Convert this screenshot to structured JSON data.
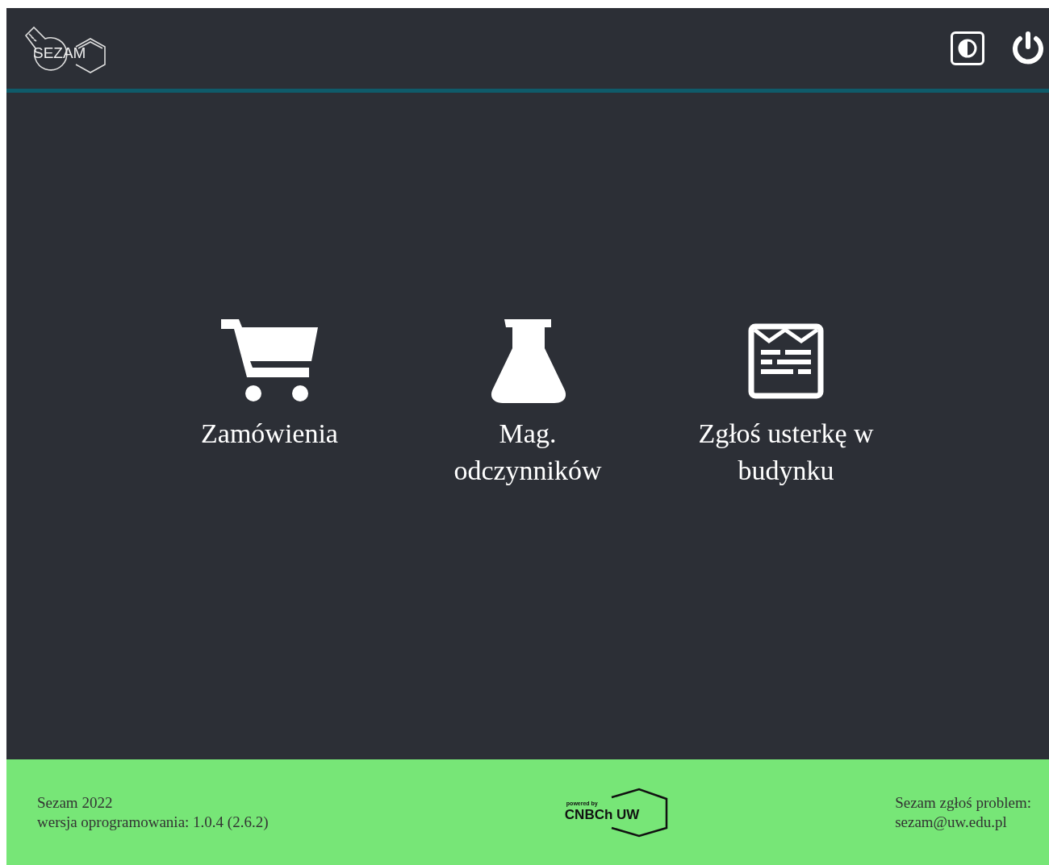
{
  "header": {
    "logo_text": "SEZAM"
  },
  "tiles": [
    {
      "kind": "cart",
      "label": "Zamówienia"
    },
    {
      "kind": "flask",
      "label": "Mag. odczynników"
    },
    {
      "kind": "report",
      "label": "Zgłoś usterkę w budynku"
    }
  ],
  "footer": {
    "left": [
      "Sezam 2022",
      "wersja oprogramowania: 1.0.4 (2.6.2)"
    ],
    "badge": {
      "top": "powered by",
      "main": "CNBCh UW"
    },
    "right": [
      "Sezam zgłoś problem:",
      "sezam@uw.edu.pl"
    ]
  }
}
